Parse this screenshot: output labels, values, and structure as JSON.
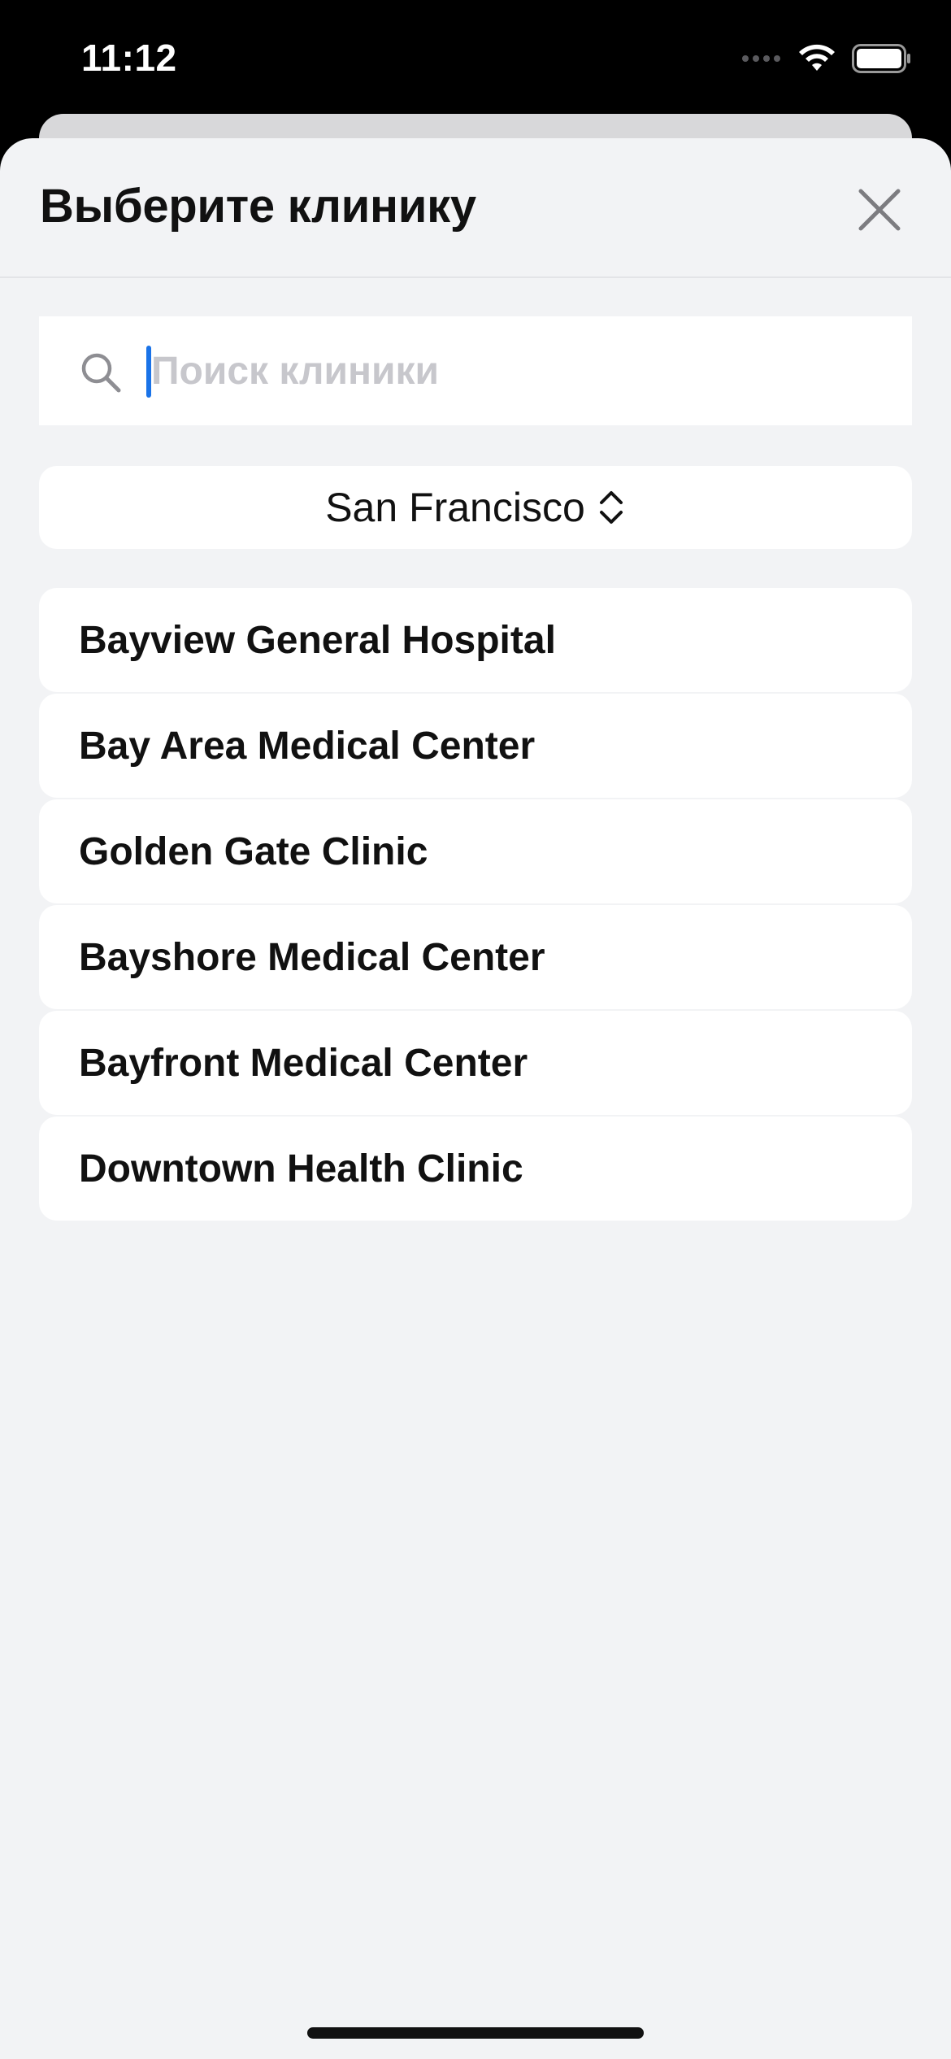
{
  "status_bar": {
    "time": "11:12",
    "icons": [
      "signal-dots-icon",
      "wifi-icon",
      "battery-icon"
    ]
  },
  "sheet": {
    "title": "Выберите клинику",
    "close_icon": "close-icon"
  },
  "search": {
    "placeholder": "Поиск клиники",
    "value": "",
    "icon": "search-icon"
  },
  "city_selector": {
    "selected": "San Francisco",
    "icon": "chevron-up-down-icon"
  },
  "clinics": [
    {
      "name": "Bayview General Hospital"
    },
    {
      "name": "Bay Area Medical Center"
    },
    {
      "name": "Golden Gate Clinic"
    },
    {
      "name": "Bayshore Medical Center"
    },
    {
      "name": "Bayfront Medical Center"
    },
    {
      "name": "Downtown Health Clinic"
    }
  ],
  "colors": {
    "sheet_background": "#f2f3f5",
    "card_background": "#ffffff",
    "caret": "#1a73e8",
    "text_primary": "#111111",
    "placeholder": "#c7c7cc"
  }
}
